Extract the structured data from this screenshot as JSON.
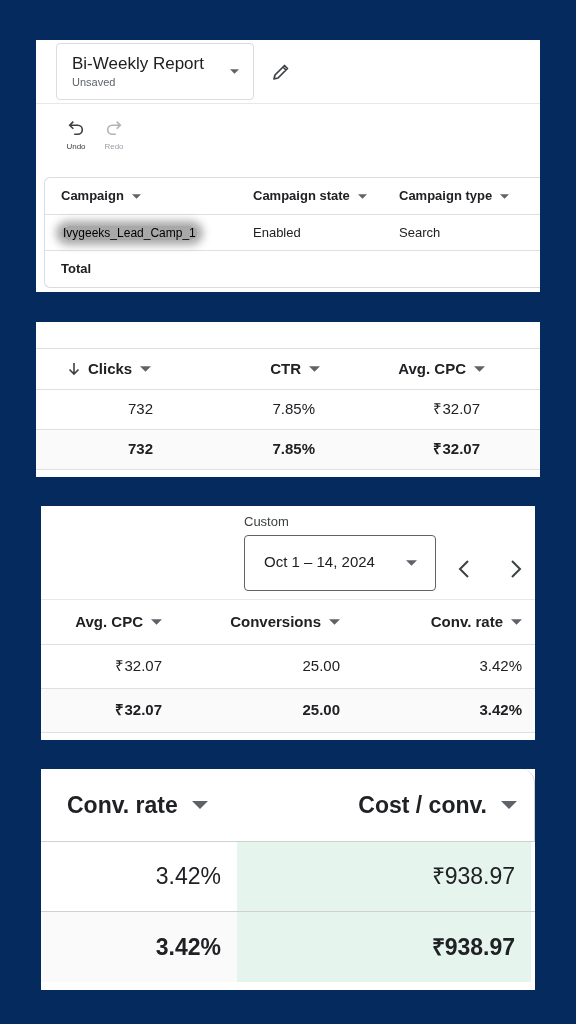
{
  "report_panel": {
    "report_selector": {
      "title": "Bi-Weekly Report",
      "status": "Unsaved"
    },
    "toolbar": [
      {
        "label": "Undo",
        "kind": "undo",
        "disabled": false
      },
      {
        "label": "Redo",
        "kind": "redo",
        "disabled": true
      }
    ],
    "table": {
      "columns": [
        {
          "label": "Campaign"
        },
        {
          "label": "Campaign state"
        },
        {
          "label": "Campaign type"
        }
      ],
      "rows": [
        {
          "kind": "data",
          "cells": [
            {
              "text": "Ivygeeks_Lead_Camp_1",
              "blurred": true
            },
            {
              "text": "Enabled",
              "blurred": false
            },
            {
              "text": "Search",
              "blurred": false
            }
          ]
        },
        {
          "kind": "total",
          "cells": [
            {
              "text": "Total",
              "blurred": false
            }
          ]
        }
      ]
    }
  },
  "metrics_panel": {
    "table": {
      "columns": [
        {
          "label": "Clicks",
          "sorted": true
        },
        {
          "label": "CTR",
          "sorted": false
        },
        {
          "label": "Avg. CPC",
          "sorted": false
        }
      ],
      "rows": [
        {
          "kind": "data",
          "cells": [
            {
              "text": "732"
            },
            {
              "text": "7.85%"
            },
            {
              "text": "₹32.07"
            }
          ]
        },
        {
          "kind": "total",
          "cells": [
            {
              "text": "732"
            },
            {
              "text": "7.85%"
            },
            {
              "text": "₹32.07"
            }
          ]
        }
      ]
    }
  },
  "conversions_panel": {
    "date_range": {
      "label": "Custom",
      "value": "Oct 1 – 14, 2024"
    },
    "table": {
      "columns": [
        {
          "label": "Avg. CPC"
        },
        {
          "label": "Conversions"
        },
        {
          "label": "Conv. rate"
        }
      ],
      "rows": [
        {
          "kind": "data",
          "cells": [
            {
              "text": "₹32.07"
            },
            {
              "text": "25.00"
            },
            {
              "text": "3.42%"
            }
          ]
        },
        {
          "kind": "total",
          "cells": [
            {
              "text": "₹32.07"
            },
            {
              "text": "25.00"
            },
            {
              "text": "3.42%"
            }
          ]
        }
      ]
    }
  },
  "cost_panel": {
    "table": {
      "columns": [
        {
          "label": "Conv. rate",
          "highlighted": false
        },
        {
          "label": "Cost / conv.",
          "highlighted": true
        }
      ],
      "rows": [
        {
          "kind": "data",
          "cells": [
            {
              "text": "3.42%"
            },
            {
              "text": "₹938.97"
            }
          ]
        },
        {
          "kind": "total",
          "cells": [
            {
              "text": "3.42%"
            },
            {
              "text": "₹938.97"
            }
          ]
        }
      ]
    }
  }
}
